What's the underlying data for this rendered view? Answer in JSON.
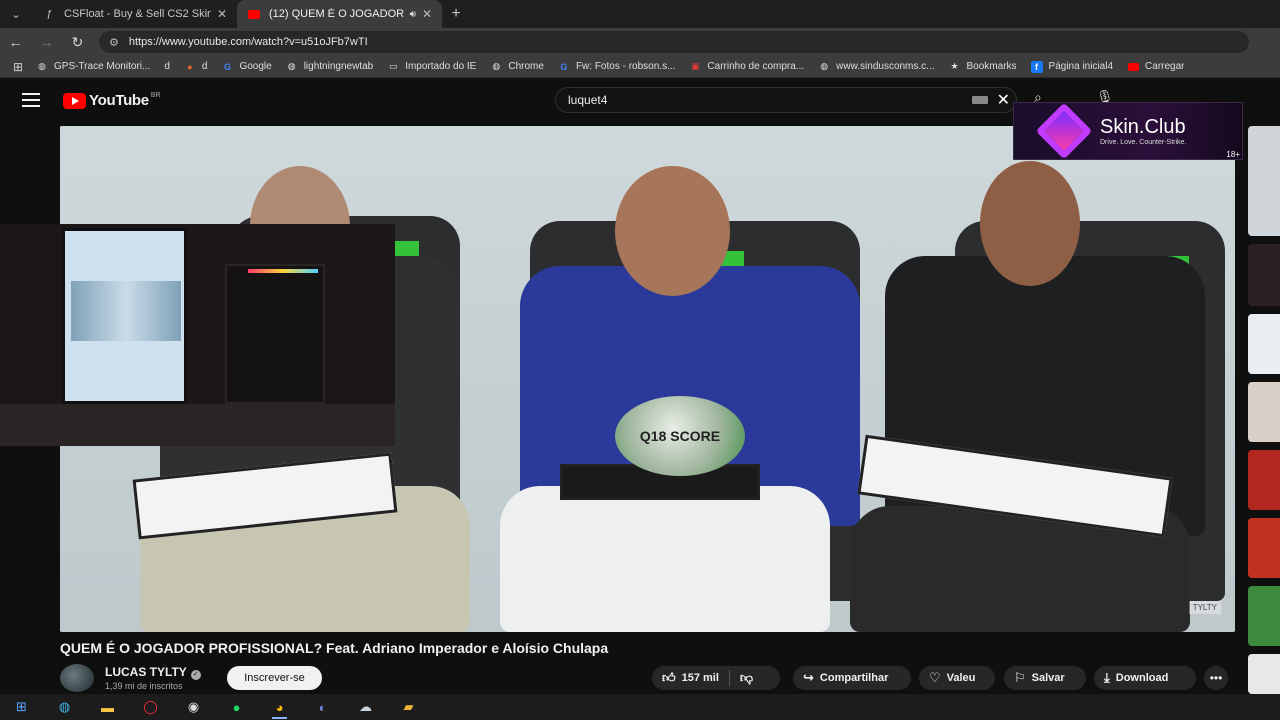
{
  "browser": {
    "tabs": [
      {
        "title": "CSFloat - Buy & Sell CS2 Skins",
        "favicon": "csfloat-icon",
        "active": false
      },
      {
        "title": "(12) QUEM É O JOGADOR P",
        "favicon": "youtube-icon",
        "active": true,
        "audio": true
      }
    ],
    "url": "https://www.youtube.com/watch?v=u51oJFb7wTI",
    "bookmarks": [
      {
        "label": "GPS-Trace Monitori...",
        "icon": "globe-icon"
      },
      {
        "label": "d",
        "icon": "none"
      },
      {
        "label": "d",
        "icon": "pepper-icon"
      },
      {
        "label": "Google",
        "icon": "google-icon"
      },
      {
        "label": "lightningnewtab",
        "icon": "globe-icon"
      },
      {
        "label": "Importado do IE",
        "icon": "folder-icon"
      },
      {
        "label": "Chrome",
        "icon": "chrome-icon"
      },
      {
        "label": "Fw: Fotos - robson.s...",
        "icon": "google-icon"
      },
      {
        "label": "Carrinho de compra...",
        "icon": "cart-icon"
      },
      {
        "label": "www.sindusconms.c...",
        "icon": "globe-icon"
      },
      {
        "label": "Bookmarks",
        "icon": "star-icon"
      },
      {
        "label": "Página inicial4",
        "icon": "facebook-icon"
      },
      {
        "label": "Carregar",
        "icon": "youtube-icon"
      }
    ]
  },
  "youtube": {
    "logo_text": "YouTube",
    "country_code": "BR",
    "search_value": "luquet4",
    "video": {
      "title": "QUEM É O JOGADOR PROFISSIONAL? Feat. Adriano Imperador e Aloísio Chulapa",
      "ball_text": "Q18 SCORE",
      "watermark": "TYLTY"
    },
    "channel": {
      "name": "LUCAS TYLTY",
      "subscribers": "1,39 mi de inscritos",
      "subscribe_label": "Inscrever-se"
    },
    "actions": {
      "likes": "157 mil",
      "share": "Compartilhar",
      "thanks": "Valeu",
      "save": "Salvar",
      "download": "Download"
    }
  },
  "ad": {
    "brand": "Skin.Club",
    "tagline": "Drive. Love. Counter-Strike.",
    "age": "18+"
  },
  "taskbar": {
    "items": [
      "windows-start-icon",
      "edge-icon",
      "file-explorer-icon",
      "opera-icon",
      "obs-icon",
      "spotify-icon",
      "chrome-icon",
      "discord-icon",
      "steam-icon",
      "app-icon"
    ]
  },
  "colors": {
    "youtube_red": "#ff0000",
    "chair_green": "#34c23a",
    "dark_bg": "#0f0f0f"
  }
}
